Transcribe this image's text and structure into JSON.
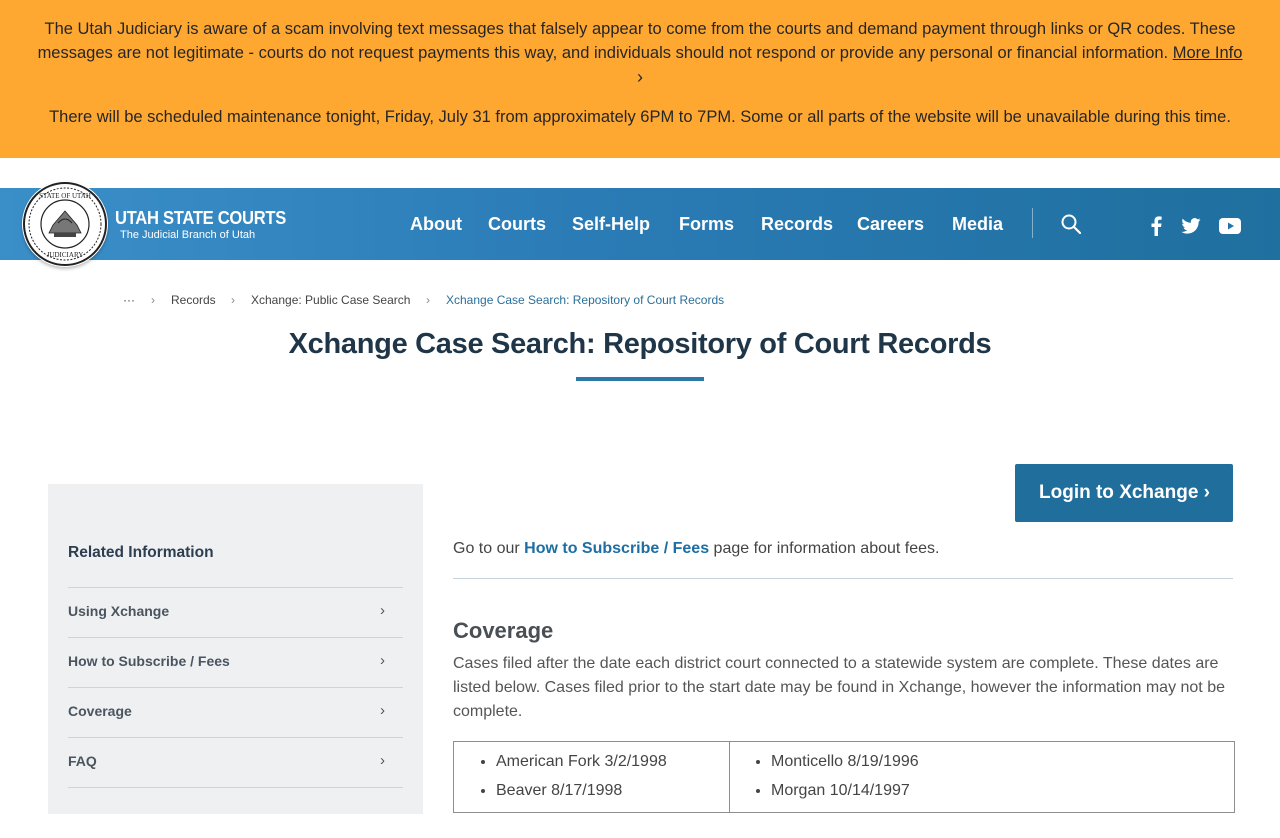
{
  "alert": {
    "message1": "The Utah Judiciary is aware of a scam involving text messages that falsely appear to come from the courts and demand payment through links or QR codes. These messages are not legitimate - courts do not request payments this way, and individuals should not respond or provide any personal or financial information.",
    "more_info_link": "More Info",
    "chevron": "›",
    "message2": "There will be scheduled maintenance tonight, Friday, July 31 from approximately 6PM to 7PM. Some or all parts of the website will be unavailable during this time."
  },
  "header": {
    "title": "UTAH STATE COURTS",
    "subtitle": "The Judicial Branch of Utah",
    "seal_text_top": "STATE OF UTAH",
    "seal_text_bottom": "JUDICIARY",
    "nav": [
      "About",
      "Courts",
      "Self-Help",
      "Forms",
      "Records",
      "Careers",
      "Media"
    ]
  },
  "breadcrumb": {
    "ellipsis": "···",
    "sep": "›",
    "items": [
      "Records",
      "Xchange: Public Case Search"
    ],
    "current": "Xchange Case Search: Repository of Court Records"
  },
  "page": {
    "title": "Xchange Case Search: Repository of Court Records",
    "login_button": "Login to Xchange ›"
  },
  "sidebar": {
    "heading": "Related Information",
    "items": [
      "Using Xchange",
      "How to Subscribe / Fees",
      "Coverage",
      "FAQ"
    ],
    "arrow": "›"
  },
  "main": {
    "intro_prefix": "Go to our ",
    "intro_link": "How to Subscribe / Fees",
    "intro_suffix": " page for information about fees.",
    "coverage_title": "Coverage",
    "coverage_text": "Cases filed after the date each district court connected to a statewide system are complete. These dates are listed below. Cases filed prior to the start date may be found in Xchange, however the information may not be complete.",
    "coverage_col1": [
      "American Fork 3/2/1998",
      "Beaver 8/17/1998"
    ],
    "coverage_col2": [
      "Monticello 8/19/1996",
      "Morgan 10/14/1997"
    ]
  },
  "colors": {
    "alert_bg": "#fea832",
    "header_blue": "#2b7cb6",
    "button_blue": "#1f6e9c",
    "link_blue": "#1d6ea3"
  }
}
